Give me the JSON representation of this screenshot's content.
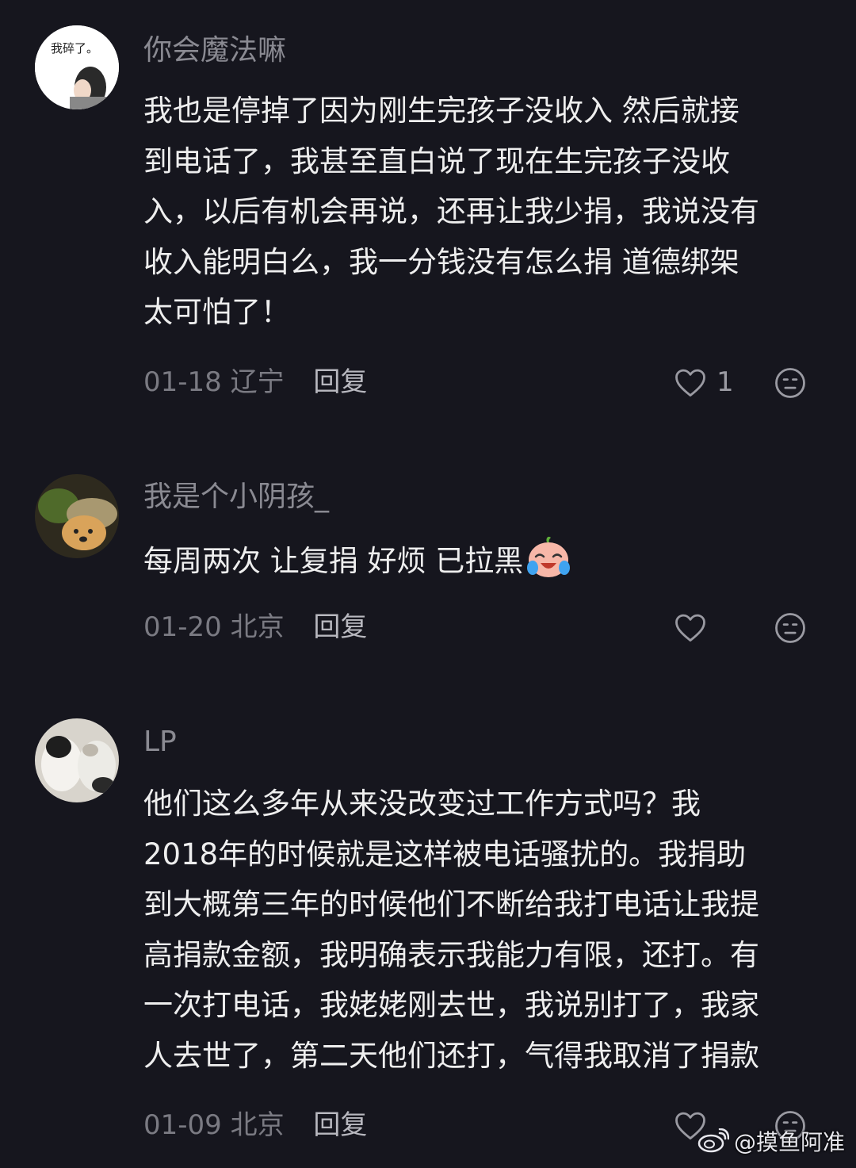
{
  "comments": [
    {
      "username": "你会魔法嘛",
      "avatar_text": "我碎了。",
      "lines": [
        "我也是停掉了因为刚生完孩子没收入 然后就接",
        "到电话了，我甚至直白说了现在生完孩子没收",
        "入，以后有机会再说，还再让我少捐，我说没有",
        "收入能明白么，我一分钱没有怎么捐 道德绑架",
        "太可怕了！"
      ],
      "date": "01-18",
      "location": "辽宁",
      "reply_label": "回复",
      "like_count": "1",
      "liked": false
    },
    {
      "username": "我是个小阴孩_",
      "lines": [
        "每周两次 让复捐 好烦 已拉黑"
      ],
      "emoji": "crying-laughing-emoji",
      "date": "01-20",
      "location": "北京",
      "reply_label": "回复",
      "like_count": "",
      "liked": false
    },
    {
      "username": "LP",
      "lines": [
        "他们这么多年从来没改变过工作方式吗？我",
        "2018年的时候就是这样被电话骚扰的。我捐助",
        "到大概第三年的时候他们不断给我打电话让我提",
        "高捐款金额，我明确表示我能力有限，还打。有",
        "一次打电话，我姥姥刚去世，我说别打了，我家",
        "人去世了，第二天他们还打，气得我取消了捐款"
      ],
      "date": "01-09",
      "location": "北京",
      "reply_label": "回复",
      "like_count": "",
      "liked": false
    }
  ],
  "watermark": {
    "text": "@摸鱼阿准"
  },
  "colors": {
    "background": "#16161e",
    "username": "#8a8a92",
    "body": "#eeeeee",
    "meta": "#7a7a82",
    "reply": "#b8b8bf"
  }
}
